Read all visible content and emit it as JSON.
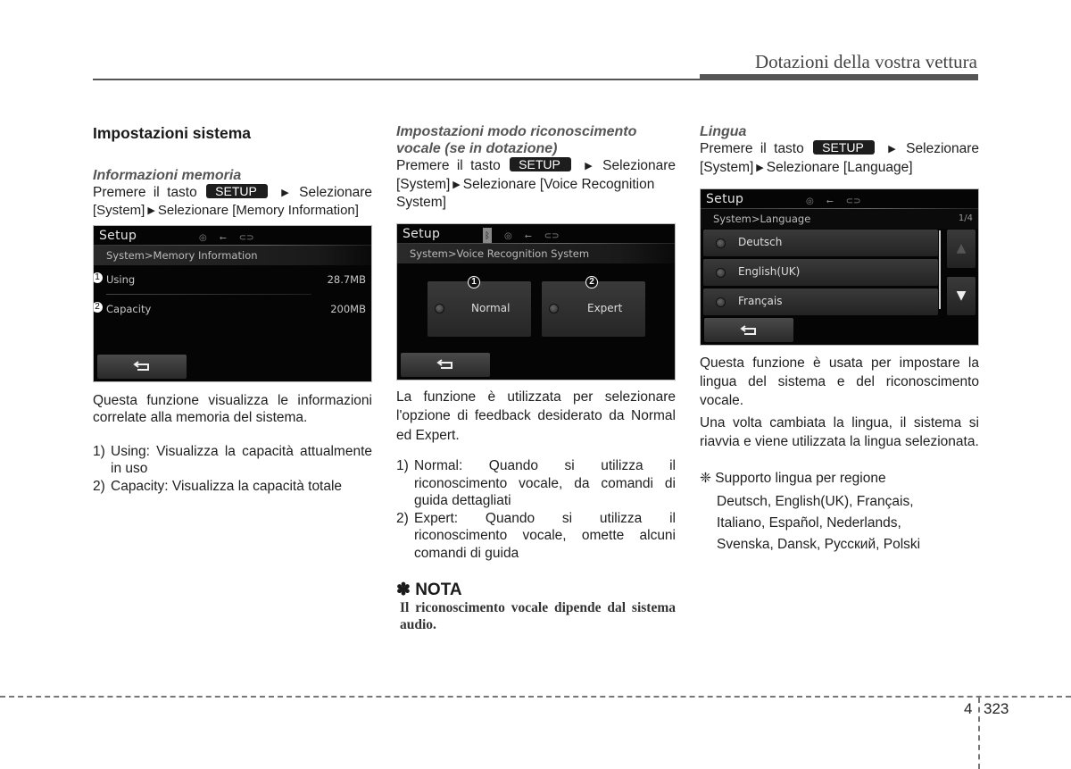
{
  "header": {
    "title": "Dotazioni della vostra vettura"
  },
  "setup_key_label": "SETUP",
  "col1": {
    "section_title": "Impostazioni sistema",
    "subtitle": "Informazioni memoria",
    "instr_line1_pre": "Premere il tasto",
    "instr_line1_post": "Selezionare",
    "instr_line2_a": "[System]",
    "instr_line2_b": "Selezionare [Memory Information]",
    "screen": {
      "title": "Setup",
      "breadcrumb": "System>Memory Information",
      "rows": [
        {
          "callout": "1",
          "label": "Using",
          "value": "28.7MB"
        },
        {
          "callout": "2",
          "label": "Capacity",
          "value": "200MB"
        }
      ]
    },
    "description": "Questa funzione visualizza le informazioni correlate alla memoria del sistema.",
    "items": [
      {
        "num": "1)",
        "text": "Using: Visualizza la capacità attualmente in uso"
      },
      {
        "num": "2)",
        "text": "Capacity: Visualizza la capacità totale"
      }
    ]
  },
  "col2": {
    "subtitle": "Impostazioni modo riconoscimento vocale (se in dotazione)",
    "instr_line1_pre": "Premere il tasto",
    "instr_line1_post": "Selezionare",
    "instr_line2_a": "[System]",
    "instr_line2_b": "Selezionare [Voice Recognition System]",
    "screen": {
      "title": "Setup",
      "breadcrumb": "System>Voice Recognition System",
      "options": [
        {
          "callout": "1",
          "label": "Normal"
        },
        {
          "callout": "2",
          "label": "Expert"
        }
      ]
    },
    "description": "La funzione è utilizzata per selezionare l'opzione di feedback desiderato da Normal ed Expert.",
    "items": [
      {
        "num": "1)",
        "text": "Normal: Quando si utilizza il riconoscimento vocale, da comandi di guida dettagliati"
      },
      {
        "num": "2)",
        "text": "Expert: Quando si utilizza il riconoscimento vocale, omette alcuni comandi di guida"
      }
    ],
    "nota_title": "✽ NOTA",
    "nota_body": "Il riconoscimento vocale dipende dal sistema audio."
  },
  "col3": {
    "subtitle": "Lingua",
    "instr_line1_pre": "Premere il tasto",
    "instr_line1_post": "Selezionare",
    "instr_line2_a": "[System]",
    "instr_line2_b": "Selezionare [Language]",
    "screen": {
      "title": "Setup",
      "breadcrumb": "System>Language",
      "page_indicator": "1/4",
      "languages": [
        "Deutsch",
        "English(UK)",
        "Français"
      ]
    },
    "description1": "Questa funzione è usata per impostare la lingua del sistema e del riconoscimento vocale.",
    "description2": "Una volta cambiata la lingua, il sistema si riavvia e viene utilizzata la lingua selezionata.",
    "support_title": "❈ Supporto lingua per regione",
    "support_lines": [
      "Deutsch, English(UK), Français,",
      "Italiano, Español, Nederlands,",
      "Svenska, Dansk, Русский, Polski"
    ]
  },
  "footer": {
    "chapter": "4",
    "page": "323"
  },
  "icons": {
    "arrow": "▶",
    "disc": "◎",
    "usb": "⭠",
    "aux": "⊂⊃",
    "bluetooth": "ᛒ",
    "up": "▲",
    "down": "▼"
  },
  "colors": {
    "screen_bg": "#050505",
    "key_bg": "#1d1d1d",
    "rule": "#555555"
  }
}
